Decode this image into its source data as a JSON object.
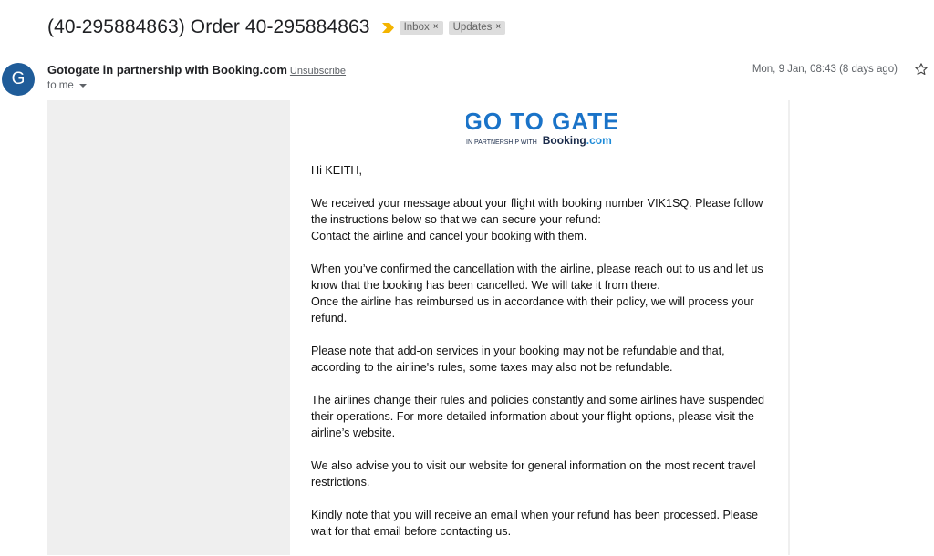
{
  "header": {
    "subject": "(40-295884863) Order 40-295884863",
    "labels": [
      {
        "name": "Inbox",
        "remove": "×"
      },
      {
        "name": "Updates",
        "remove": "×"
      }
    ]
  },
  "message": {
    "avatar_letter": "G",
    "sender": "Gotogate in partnership with Booking.com",
    "unsubscribe": "Unsubscribe",
    "recipient": "to me",
    "timestamp": "Mon, 9 Jan, 08:43 (8 days ago)",
    "icons": [
      "important-marker-icon",
      "chevron-down-icon",
      "star-icon"
    ],
    "colors": {
      "avatar": "#1f5c99",
      "brand_blue": "#1a73c8",
      "important": "#f4b400",
      "email_background": "#efefef"
    }
  },
  "logo": {
    "wordmark": "GO TO GATE",
    "partnership": "IN PARTNERSHIP WITH",
    "booking_prefix": "Booking",
    "booking_suffix": ".com"
  },
  "email": {
    "greeting": "Hi KEITH,",
    "paragraphs": [
      " We received your message about your flight with booking number VIK1SQ. Please follow the instructions below so that we can secure your refund:\n Contact the airline and cancel your booking with them.",
      " When you’ve confirmed the cancellation with the airline, please reach out to us and let us know that the booking has been cancelled. We will take it from there.\n Once the airline has reimbursed us in accordance with their policy, we will process your refund.",
      " Please note that add-on services in your booking may not be refundable and that, according to the airline's rules, some taxes may also not be refundable.",
      " The airlines change their rules and policies constantly and some airlines have suspended their operations. For more detailed information about your flight options, please visit the airline’s website.",
      " We also advise you to visit our website for general information on the most recent travel restrictions.",
      " Kindly note that you will receive an email when your refund has been processed. Please wait for that email before contacting us."
    ]
  }
}
